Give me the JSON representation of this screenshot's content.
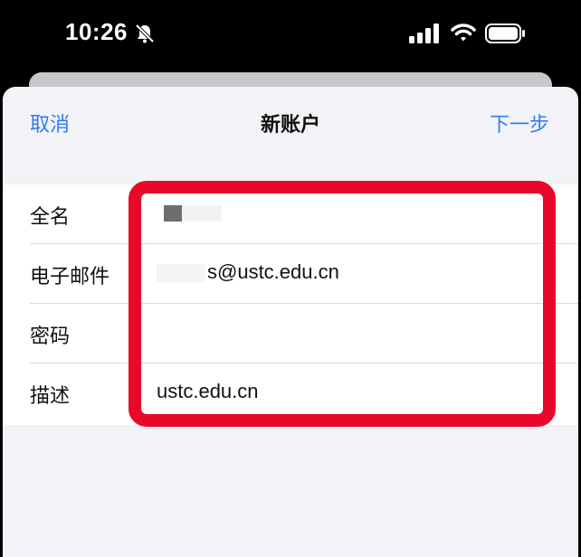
{
  "status_bar": {
    "time": "10:26",
    "icons": [
      "bell-slash-icon",
      "cellular-signal-icon",
      "wifi-icon",
      "battery-icon"
    ]
  },
  "nav": {
    "cancel_label": "取消",
    "title": "新账户",
    "next_label": "下一步"
  },
  "form": {
    "fields": [
      {
        "label": "全名",
        "value": ""
      },
      {
        "label": "电子邮件",
        "value": "s@ustc.edu.cn"
      },
      {
        "label": "密码",
        "value": ""
      },
      {
        "label": "描述",
        "value": "ustc.edu.cn"
      }
    ]
  },
  "colors": {
    "accent": "#2f7cf6",
    "highlight": "#e8092a",
    "sheet_background": "#f2f2f7"
  }
}
